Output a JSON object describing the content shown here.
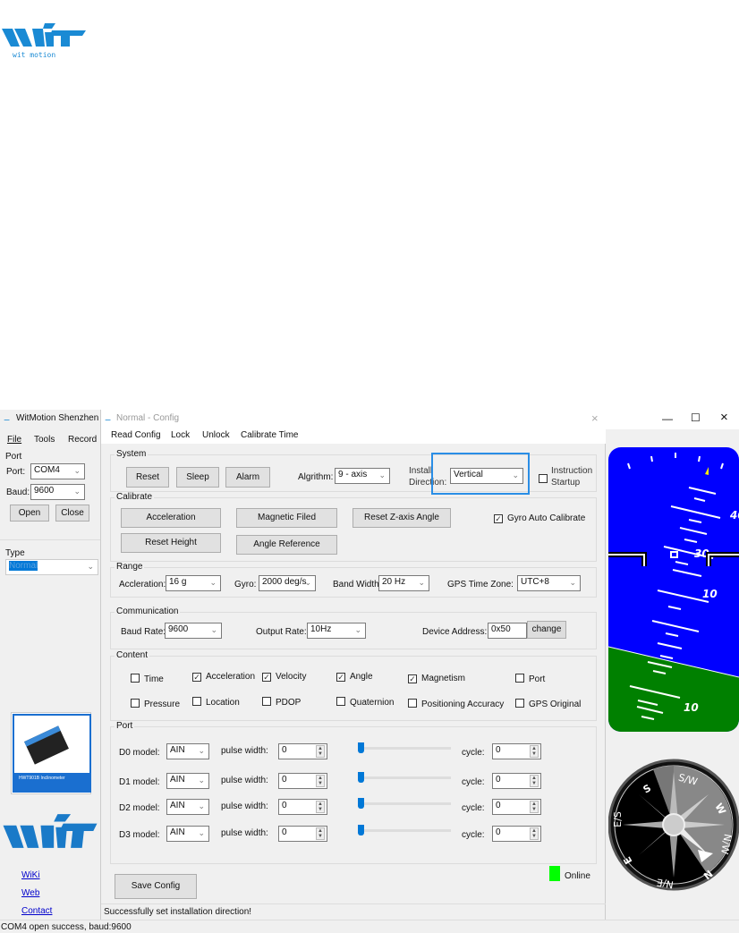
{
  "brand": {
    "logo_text": "wit motion"
  },
  "main_window": {
    "title": "WitMotion Shenzhen (",
    "menu": [
      "File",
      "Tools",
      "Record"
    ],
    "port_group": "Port",
    "port_label": "Port:",
    "port_value": "COM4",
    "baud_label": "Baud:",
    "baud_value": "9600",
    "open": "Open",
    "close": "Close",
    "type_group": "Type",
    "type_value": "Normal",
    "links": [
      "WiKi",
      "Web",
      "Contact"
    ],
    "product_caption": "HWT901B Inclinometer",
    "status": "COM4 open success, baud:9600"
  },
  "dialog": {
    "title": "Normal - Config",
    "menu": [
      "Read Config",
      "Lock",
      "Unlock",
      "Calibrate Time"
    ],
    "system": {
      "title": "System",
      "buttons": [
        "Reset",
        "Sleep",
        "Alarm"
      ],
      "algorithm_label": "Algrithm:",
      "algorithm_value": "9 - axis",
      "install_label_1": "Install",
      "install_label_2": "Direction:",
      "install_value": "Vertical",
      "instruction_1": "Instruction",
      "instruction_2": "Startup"
    },
    "calibrate": {
      "title": "Calibrate",
      "acceleration": "Acceleration",
      "magnetic": "Magnetic Filed",
      "reset_z": "Reset Z-axis Angle",
      "reset_height": "Reset Height",
      "angle_ref": "Angle Reference",
      "gyro_auto": "Gyro Auto Calibrate"
    },
    "range": {
      "title": "Range",
      "accel_label": "Accleration:",
      "accel_value": "16 g",
      "gyro_label": "Gyro:",
      "gyro_value": "2000 deg/s",
      "bw_label": "Band Width:",
      "bw_value": "20  Hz",
      "tz_label": "GPS Time Zone:",
      "tz_value": "UTC+8"
    },
    "communication": {
      "title": "Communication",
      "baud_label": "Baud Rate:",
      "baud_value": "9600",
      "rate_label": "Output Rate:",
      "rate_value": "10Hz",
      "addr_label": "Device Address:",
      "addr_value": "0x50",
      "change": "change"
    },
    "content": {
      "title": "Content",
      "items": [
        {
          "label": "Time",
          "checked": false
        },
        {
          "label": "Acceleration",
          "checked": true
        },
        {
          "label": "Velocity",
          "checked": true
        },
        {
          "label": "Angle",
          "checked": true
        },
        {
          "label": "Magnetism",
          "checked": true
        },
        {
          "label": "Port",
          "checked": false
        },
        {
          "label": "Pressure",
          "checked": false
        },
        {
          "label": "Location",
          "checked": false
        },
        {
          "label": "PDOP",
          "checked": false
        },
        {
          "label": "Quaternion",
          "checked": false
        },
        {
          "label": "Positioning Accuracy",
          "checked": false
        },
        {
          "label": "GPS Original",
          "checked": false
        }
      ]
    },
    "port": {
      "title": "Port",
      "pulse_label": "pulse width:",
      "cycle_label": "cycle:",
      "rows": [
        {
          "label": "D0 model:",
          "mode": "AIN",
          "pulse": "0",
          "cycle": "0",
          "slider": 0
        },
        {
          "label": "D1 model:",
          "mode": "AIN",
          "pulse": "0",
          "cycle": "0",
          "slider": 0
        },
        {
          "label": "D2 model:",
          "mode": "AIN",
          "pulse": "0",
          "cycle": "0",
          "slider": 0
        },
        {
          "label": "D3 model:",
          "mode": "AIN",
          "pulse": "0",
          "cycle": "0",
          "slider": 0
        }
      ]
    },
    "save": "Save Config",
    "online": "Online",
    "online_color": "#00ff00",
    "status": "Successfully set installation direction!"
  },
  "attitude": {
    "labels": [
      "40",
      "30",
      "10",
      "10"
    ],
    "sky_color": "#0000ff",
    "ground_color": "#008000"
  },
  "compass": {
    "labels": [
      "S",
      "S/W",
      "W",
      "N/W",
      "N",
      "N/E",
      "E",
      "E/S"
    ]
  },
  "accent": "#2a8ee6"
}
